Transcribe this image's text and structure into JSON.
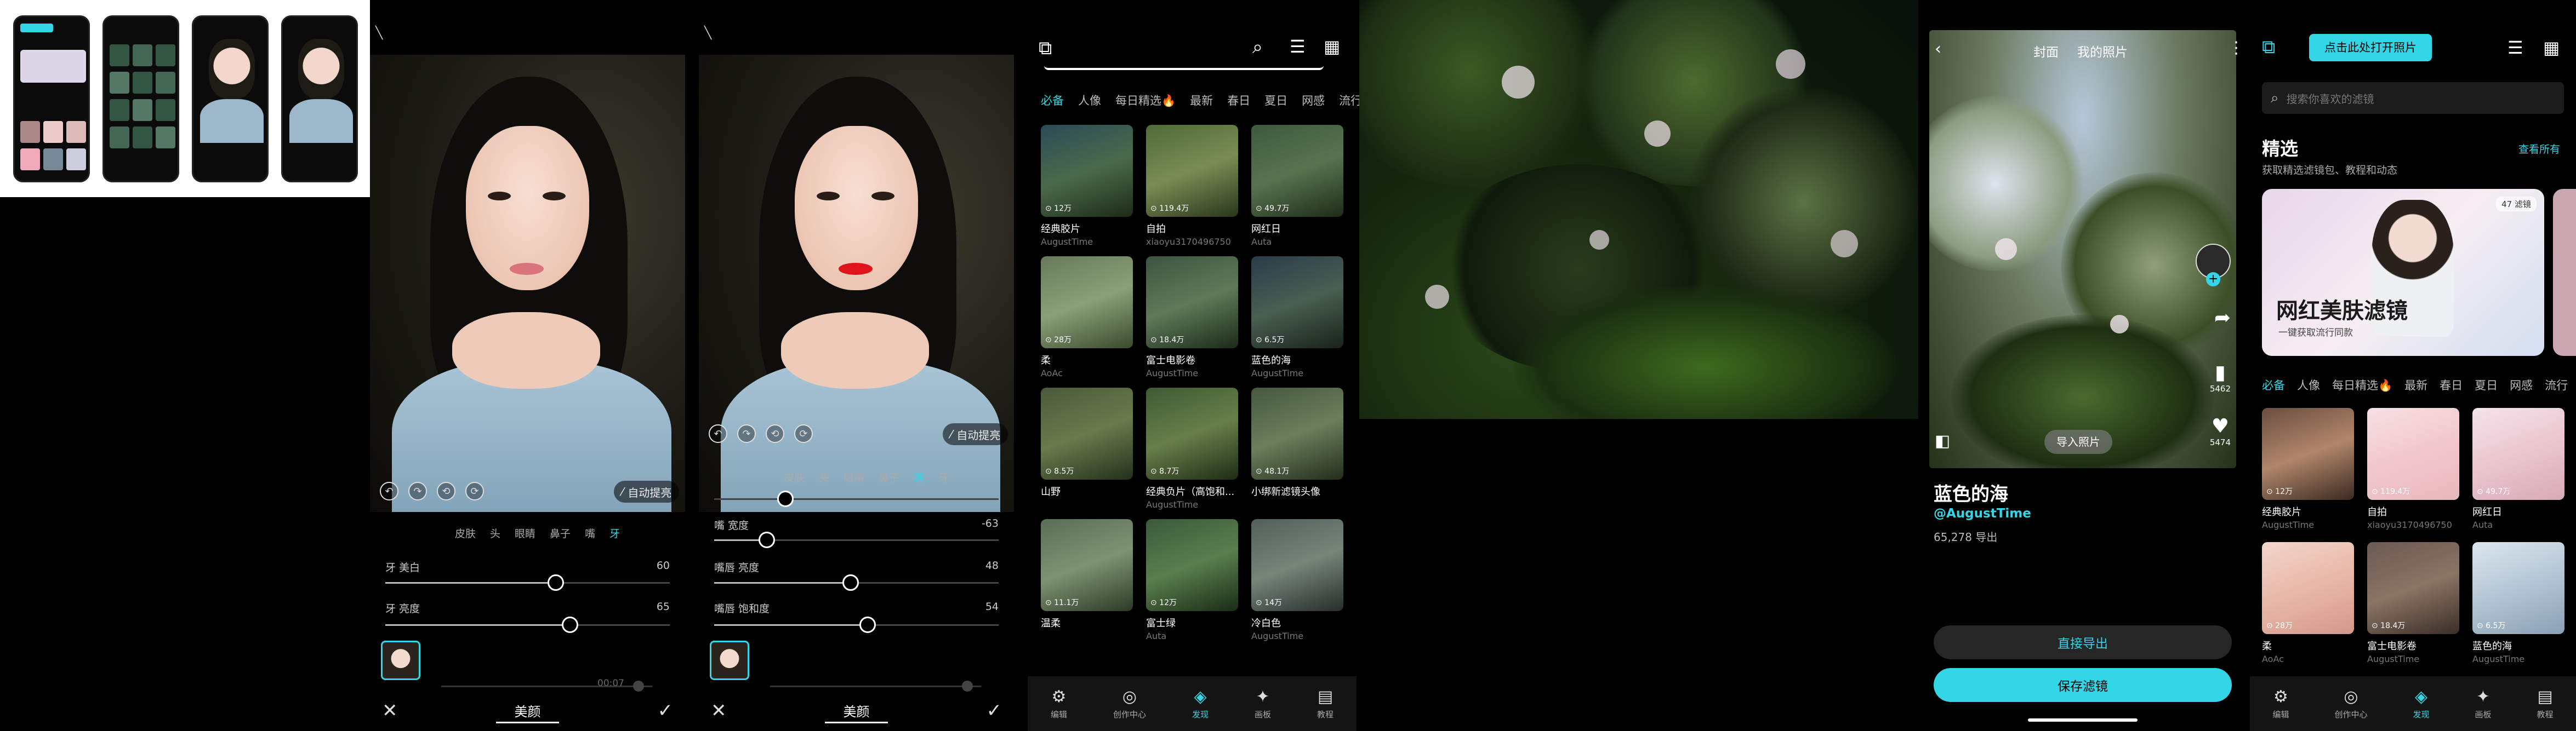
{
  "editor": {
    "tabs": [
      "皮肤",
      "头",
      "眼睛",
      "鼻子",
      "嘴",
      "牙"
    ],
    "auto_label": "自动提亮",
    "bottom_title": "美颜",
    "time_label": "00:07"
  },
  "editor1": {
    "active_tab": "牙",
    "sliders": [
      {
        "label": "牙 美白",
        "value": "60",
        "level": 0.6
      },
      {
        "label": "牙 亮度",
        "value": "65",
        "level": 0.65
      }
    ]
  },
  "editor2": {
    "active_tab": "嘴",
    "sliders": [
      {
        "label": "嘴 宽度",
        "value": "-63",
        "level": 0.185
      },
      {
        "label": "嘴唇 亮度",
        "value": "48",
        "level": 0.48
      },
      {
        "label": "嘴唇 饱和度",
        "value": "54",
        "level": 0.54
      }
    ]
  },
  "filters_page": {
    "categories": [
      "必备",
      "人像",
      "每日精选🔥",
      "最新",
      "春日",
      "夏日",
      "网感",
      "流行"
    ],
    "active_category": "必备",
    "items": [
      {
        "name": "经典胶片",
        "author": "AugustTime",
        "count": "⊙ 12万"
      },
      {
        "name": "自拍",
        "author": "xiaoyu3170496750",
        "count": "⊙ 119.4万"
      },
      {
        "name": "网红日",
        "author": "Auta",
        "count": "⊙ 49.7万"
      },
      {
        "name": "柔",
        "author": "AoAc",
        "count": "⊙ 28万"
      },
      {
        "name": "富士电影卷",
        "author": "AugustTime",
        "count": "⊙ 18.4万"
      },
      {
        "name": "蓝色的海",
        "author": "AugustTime",
        "count": "⊙ 6.5万"
      },
      {
        "name": "山野",
        "author": "",
        "count": "⊙ 8.5万"
      },
      {
        "name": "经典负片（高饱和...",
        "author": "AugustTime",
        "count": "⊙ 8.7万"
      },
      {
        "name": "小绑新滤镜头像",
        "author": "",
        "count": "⊙ 48.1万"
      },
      {
        "name": "温柔",
        "author": "",
        "count": "⊙ 11.1万"
      },
      {
        "name": "富士绿",
        "author": "Auta",
        "count": "⊙ 12万"
      },
      {
        "name": "冷白色",
        "author": "AugustTime",
        "count": "⊙ 14万"
      }
    ]
  },
  "nav": [
    {
      "label": "编辑",
      "icon": "⚙"
    },
    {
      "label": "创作中心",
      "icon": "◎"
    },
    {
      "label": "发现",
      "icon": "◈"
    },
    {
      "label": "画板",
      "icon": "✦"
    },
    {
      "label": "教程",
      "icon": "▤"
    }
  ],
  "nav_active": "发现",
  "detail": {
    "tab_cover": "封面",
    "tab_mine": "我的照片",
    "import_label": "导入照片",
    "bookmark_count": "5462",
    "like_count": "5474",
    "title": "蓝色的海",
    "author": "@AugustTime",
    "exports": "65,278 导出",
    "direct_export": "直接导出",
    "save_filter": "保存滤镜"
  },
  "home": {
    "open_photo": "点击此处打开照片",
    "search_placeholder": "搜索你喜欢的滤镜",
    "section_title": "精选",
    "view_all": "查看所有",
    "section_sub": "获取精选滤镜包、教程和动态",
    "banner_badge": "47 滤镜",
    "banner_title": "网红美肤滤镜",
    "banner_sub": "一键获取流行同款",
    "categories": [
      "必备",
      "人像",
      "每日精选🔥",
      "最新",
      "春日",
      "夏日",
      "网感",
      "流行"
    ],
    "active_category": "必备",
    "items": [
      {
        "name": "经典胶片",
        "author": "AugustTime",
        "count": "⊙ 12万"
      },
      {
        "name": "自拍",
        "author": "xiaoyu3170496750",
        "count": "⊙ 119.4万"
      },
      {
        "name": "网红日",
        "author": "Auta",
        "count": "⊙ 49.7万"
      },
      {
        "name": "柔",
        "author": "AoAc",
        "count": "⊙ 28万"
      },
      {
        "name": "富士电影卷",
        "author": "AugustTime",
        "count": "⊙ 18.4万"
      },
      {
        "name": "蓝色的海",
        "author": "AugustTime",
        "count": "⊙ 6.5万"
      }
    ]
  },
  "colors": {
    "accent": "#33d6e6"
  }
}
